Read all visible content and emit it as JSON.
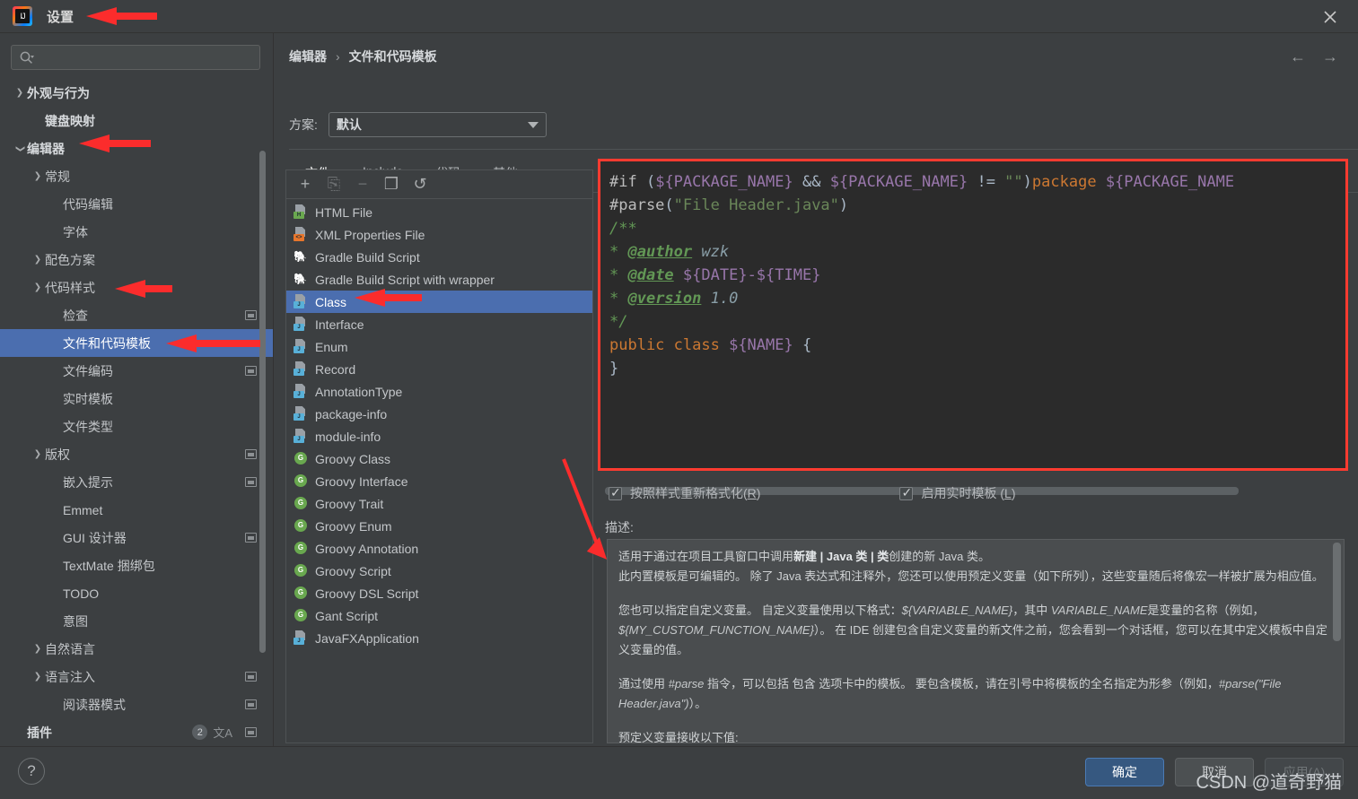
{
  "window": {
    "title": "设置",
    "logo_text": "IJ",
    "close_label": "✕"
  },
  "sidebar": {
    "search_placeholder": "",
    "search_value": "",
    "items": [
      {
        "label": "外观与行为",
        "arrow": "›",
        "indent": 0,
        "bold": true,
        "selected": false,
        "win": false
      },
      {
        "label": "键盘映射",
        "arrow": "",
        "indent": 1,
        "bold": true,
        "selected": false,
        "win": false
      },
      {
        "label": "编辑器",
        "arrow": "⌄",
        "indent": 0,
        "bold": true,
        "selected": false,
        "win": false
      },
      {
        "label": "常规",
        "arrow": "›",
        "indent": 1,
        "bold": false,
        "selected": false,
        "win": false
      },
      {
        "label": "代码编辑",
        "arrow": "",
        "indent": 2,
        "bold": false,
        "selected": false,
        "win": false
      },
      {
        "label": "字体",
        "arrow": "",
        "indent": 2,
        "bold": false,
        "selected": false,
        "win": false
      },
      {
        "label": "配色方案",
        "arrow": "›",
        "indent": 1,
        "bold": false,
        "selected": false,
        "win": false
      },
      {
        "label": "代码样式",
        "arrow": "›",
        "indent": 1,
        "bold": false,
        "selected": false,
        "win": false
      },
      {
        "label": "检查",
        "arrow": "",
        "indent": 2,
        "bold": false,
        "selected": false,
        "win": true
      },
      {
        "label": "文件和代码模板",
        "arrow": "",
        "indent": 2,
        "bold": false,
        "selected": true,
        "win": false
      },
      {
        "label": "文件编码",
        "arrow": "",
        "indent": 2,
        "bold": false,
        "selected": false,
        "win": true
      },
      {
        "label": "实时模板",
        "arrow": "",
        "indent": 2,
        "bold": false,
        "selected": false,
        "win": false
      },
      {
        "label": "文件类型",
        "arrow": "",
        "indent": 2,
        "bold": false,
        "selected": false,
        "win": false
      },
      {
        "label": "版权",
        "arrow": "›",
        "indent": 1,
        "bold": false,
        "selected": false,
        "win": true
      },
      {
        "label": "嵌入提示",
        "arrow": "",
        "indent": 2,
        "bold": false,
        "selected": false,
        "win": true
      },
      {
        "label": "Emmet",
        "arrow": "",
        "indent": 2,
        "bold": false,
        "selected": false,
        "win": false
      },
      {
        "label": "GUI 设计器",
        "arrow": "",
        "indent": 2,
        "bold": false,
        "selected": false,
        "win": true
      },
      {
        "label": "TextMate 捆绑包",
        "arrow": "",
        "indent": 2,
        "bold": false,
        "selected": false,
        "win": false
      },
      {
        "label": "TODO",
        "arrow": "",
        "indent": 2,
        "bold": false,
        "selected": false,
        "win": false
      },
      {
        "label": "意图",
        "arrow": "",
        "indent": 2,
        "bold": false,
        "selected": false,
        "win": false
      },
      {
        "label": "自然语言",
        "arrow": "›",
        "indent": 1,
        "bold": false,
        "selected": false,
        "win": false
      },
      {
        "label": "语言注入",
        "arrow": "›",
        "indent": 1,
        "bold": false,
        "selected": false,
        "win": true
      },
      {
        "label": "阅读器模式",
        "arrow": "",
        "indent": 2,
        "bold": false,
        "selected": false,
        "win": true
      },
      {
        "label": "插件",
        "arrow": "",
        "indent": 0,
        "bold": true,
        "selected": false,
        "win": true,
        "badge": "2",
        "translate": "文A"
      }
    ]
  },
  "main": {
    "breadcrumb": {
      "parent": "编辑器",
      "separator": "›",
      "current": "文件和代码模板"
    },
    "nav": {
      "back": "←",
      "forward": "→"
    },
    "scheme": {
      "label": "方案:",
      "value": "默认"
    },
    "tabs": [
      {
        "label": "文件",
        "active": true
      },
      {
        "label": "Include",
        "active": false
      },
      {
        "label": "代码",
        "active": false
      },
      {
        "label": "其他",
        "active": false
      }
    ]
  },
  "template_list": {
    "toolbar": [
      {
        "name": "add",
        "glyph": "+",
        "disabled": false
      },
      {
        "name": "copy-template",
        "glyph": "⎘",
        "disabled": true
      },
      {
        "name": "remove",
        "glyph": "−",
        "disabled": true
      },
      {
        "name": "duplicate",
        "glyph": "❐",
        "disabled": false
      },
      {
        "name": "reset",
        "glyph": "↺",
        "disabled": false
      }
    ],
    "items": [
      {
        "label": "HTML File",
        "icon": "java-file",
        "tag": "H",
        "tag_color": "#6aa84f",
        "selected": false
      },
      {
        "label": "XML Properties File",
        "icon": "java-file",
        "tag": "<>",
        "tag_color": "#e8762c",
        "selected": false
      },
      {
        "label": "Gradle Build Script",
        "icon": "gradle",
        "tag": "",
        "tag_color": "",
        "selected": false
      },
      {
        "label": "Gradle Build Script with wrapper",
        "icon": "gradle",
        "tag": "",
        "tag_color": "",
        "selected": false
      },
      {
        "label": "Class",
        "icon": "java-file",
        "tag": "J",
        "tag_color": "#58b0d8",
        "selected": true
      },
      {
        "label": "Interface",
        "icon": "java-file",
        "tag": "J",
        "tag_color": "#58b0d8",
        "selected": false
      },
      {
        "label": "Enum",
        "icon": "java-file",
        "tag": "J",
        "tag_color": "#58b0d8",
        "selected": false
      },
      {
        "label": "Record",
        "icon": "java-file",
        "tag": "J",
        "tag_color": "#58b0d8",
        "selected": false
      },
      {
        "label": "AnnotationType",
        "icon": "java-file",
        "tag": "J",
        "tag_color": "#58b0d8",
        "selected": false
      },
      {
        "label": "package-info",
        "icon": "java-file",
        "tag": "J",
        "tag_color": "#58b0d8",
        "selected": false
      },
      {
        "label": "module-info",
        "icon": "java-file",
        "tag": "J",
        "tag_color": "#58b0d8",
        "selected": false
      },
      {
        "label": "Groovy Class",
        "icon": "groovy",
        "tag": "G",
        "tag_color": "#69a84f",
        "selected": false
      },
      {
        "label": "Groovy Interface",
        "icon": "groovy",
        "tag": "G",
        "tag_color": "#69a84f",
        "selected": false
      },
      {
        "label": "Groovy Trait",
        "icon": "groovy",
        "tag": "G",
        "tag_color": "#69a84f",
        "selected": false
      },
      {
        "label": "Groovy Enum",
        "icon": "groovy",
        "tag": "G",
        "tag_color": "#69a84f",
        "selected": false
      },
      {
        "label": "Groovy Annotation",
        "icon": "groovy",
        "tag": "G",
        "tag_color": "#69a84f",
        "selected": false
      },
      {
        "label": "Groovy Script",
        "icon": "groovy",
        "tag": "G",
        "tag_color": "#69a84f",
        "selected": false
      },
      {
        "label": "Groovy DSL Script",
        "icon": "groovy",
        "tag": "G",
        "tag_color": "#69a84f",
        "selected": false
      },
      {
        "label": "Gant Script",
        "icon": "groovy",
        "tag": "G",
        "tag_color": "#69a84f",
        "selected": false
      },
      {
        "label": "JavaFXApplication",
        "icon": "java-file",
        "tag": "J",
        "tag_color": "#58b0d8",
        "selected": false
      }
    ]
  },
  "editor": {
    "code_lines": [
      [
        {
          "t": "#if ",
          "c": "c-dir"
        },
        {
          "t": "(",
          "c": "c-punct"
        },
        {
          "t": "${PACKAGE_NAME}",
          "c": "c-var"
        },
        {
          "t": " && ",
          "c": "c-punct"
        },
        {
          "t": "${PACKAGE_NAME}",
          "c": "c-var"
        },
        {
          "t": " != ",
          "c": "c-punct"
        },
        {
          "t": "\"\"",
          "c": "c-str"
        },
        {
          "t": ")",
          "c": "c-punct"
        },
        {
          "t": "package",
          "c": "c-kw"
        },
        {
          "t": " ",
          "c": "c-punct"
        },
        {
          "t": "${PACKAGE_NAME",
          "c": "c-var"
        }
      ],
      [
        {
          "t": "#parse",
          "c": "c-dir"
        },
        {
          "t": "(",
          "c": "c-punct"
        },
        {
          "t": "\"File Header.java\"",
          "c": "c-str"
        },
        {
          "t": ")",
          "c": "c-punct"
        }
      ],
      [
        {
          "t": "/**",
          "c": "c-cmt"
        }
      ],
      [
        {
          "t": "* ",
          "c": "c-cmt"
        },
        {
          "t": "@author",
          "c": "c-tag"
        },
        {
          "t": " wzk",
          "c": "c-cmtv"
        }
      ],
      [
        {
          "t": "* ",
          "c": "c-cmt"
        },
        {
          "t": "@date",
          "c": "c-tag"
        },
        {
          "t": " ",
          "c": "c-cmtv"
        },
        {
          "t": "${DATE}-${TIME}",
          "c": "c-var"
        }
      ],
      [
        {
          "t": "* ",
          "c": "c-cmt"
        },
        {
          "t": "@version",
          "c": "c-tag"
        },
        {
          "t": " 1.0",
          "c": "c-cmtv"
        }
      ],
      [
        {
          "t": "*/",
          "c": "c-cmt"
        }
      ],
      [
        {
          "t": "public class",
          "c": "c-kw"
        },
        {
          "t": " ",
          "c": "c-punct"
        },
        {
          "t": "${NAME}",
          "c": "c-var"
        },
        {
          "t": " {",
          "c": "c-punct"
        }
      ],
      [
        {
          "t": "}",
          "c": "c-punct"
        }
      ]
    ],
    "checkbox_reformat": {
      "label_pre": "按照样式重新格式化(",
      "mnemonic": "R",
      "label_post": ")",
      "checked": true
    },
    "checkbox_livetemplate": {
      "label_pre": "启用实时模板 (",
      "mnemonic": "L",
      "label_post": ")",
      "checked": true
    },
    "description_label": "描述:",
    "description": {
      "p1_a": "适用于通过在项目工具窗口中调用",
      "p1_new": "新建 | Java 类 | 类",
      "p1_b": "创建的新 Java 类。",
      "p2": "此内置模板是可编辑的。 除了 Java 表达式和注释外，您还可以使用预定义变量（如下所列），这些变量随后将像宏一样被扩展为相应值。",
      "p3_a": "您也可以指定自定义变量。 自定义变量使用以下格式：",
      "p3_var": "${VARIABLE_NAME}",
      "p3_b": "，其中 ",
      "p3_var2": "VARIABLE_NAME",
      "p3_c": "是变量的名称（例如，",
      "p3_var3": "${MY_CUSTOM_FUNCTION_NAME}",
      "p3_d": "）。 在 IDE 创建包含自定义变量的新文件之前，您会看到一个对话框，您可以在其中定义模板中自定义变量的值。",
      "p4_a": "通过使用 ",
      "p4_parse": "#parse",
      "p4_b": " 指令，可以包括 ",
      "p4_inc": "包含",
      "p4_c": " 选项卡中的模板。 要包含模板，请在引号中将模板的全名指定为形参（例如，",
      "p4_ex": "#parse(\"File Header.java\")",
      "p4_d": "）。",
      "p5": "预定义变量接收以下值:"
    }
  },
  "bottom": {
    "help": "?",
    "ok": "确定",
    "cancel": "取消",
    "apply": "应用(A)",
    "watermark": "CSDN @道奇野猫"
  }
}
